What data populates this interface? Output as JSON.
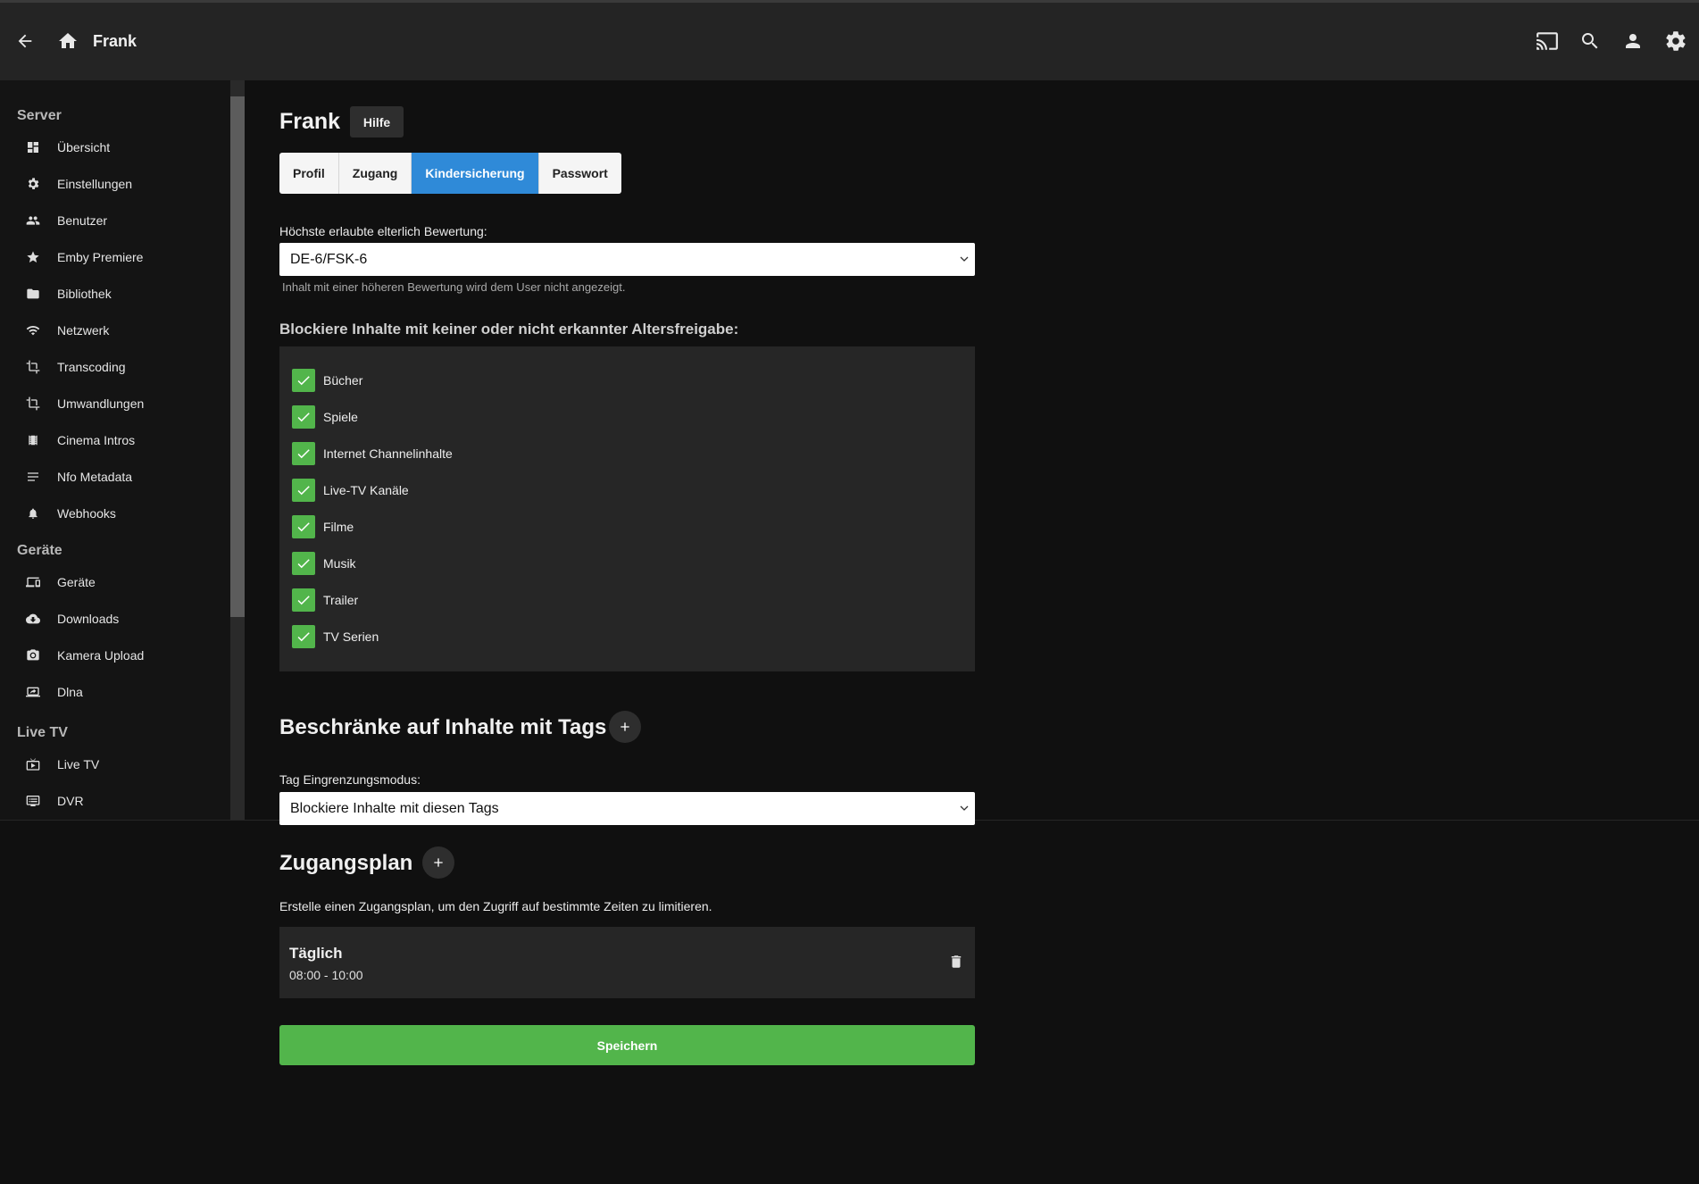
{
  "header": {
    "title": "Frank",
    "icons": [
      "back-arrow-icon",
      "home-icon",
      "cast-icon",
      "search-icon",
      "user-icon",
      "gear-icon"
    ]
  },
  "sidebar": {
    "sections": [
      {
        "title": "Server",
        "items": [
          {
            "label": "Übersicht",
            "icon": "dashboard-icon"
          },
          {
            "label": "Einstellungen",
            "icon": "gear-icon"
          },
          {
            "label": "Benutzer",
            "icon": "people-icon"
          },
          {
            "label": "Emby Premiere",
            "icon": "star-icon"
          },
          {
            "label": "Bibliothek",
            "icon": "folder-icon"
          },
          {
            "label": "Netzwerk",
            "icon": "wifi-icon"
          },
          {
            "label": "Transcoding",
            "icon": "crop-icon"
          },
          {
            "label": "Umwandlungen",
            "icon": "crop-icon"
          },
          {
            "label": "Cinema Intros",
            "icon": "film-icon"
          },
          {
            "label": "Nfo Metadata",
            "icon": "lines-icon"
          },
          {
            "label": "Webhooks",
            "icon": "bell-icon"
          }
        ]
      },
      {
        "title": "Geräte",
        "items": [
          {
            "label": "Geräte",
            "icon": "devices-icon"
          },
          {
            "label": "Downloads",
            "icon": "cloud-download-icon"
          },
          {
            "label": "Kamera Upload",
            "icon": "camera-icon"
          },
          {
            "label": "Dlna",
            "icon": "screen-share-icon"
          }
        ]
      },
      {
        "title": "Live TV",
        "items": [
          {
            "label": "Live TV",
            "icon": "live-tv-icon"
          },
          {
            "label": "DVR",
            "icon": "dvr-icon"
          }
        ]
      }
    ]
  },
  "main": {
    "title": "Frank",
    "help_label": "Hilfe",
    "tabs": [
      {
        "label": "Profil",
        "active": false
      },
      {
        "label": "Zugang",
        "active": false
      },
      {
        "label": "Kindersicherung",
        "active": true
      },
      {
        "label": "Passwort",
        "active": false
      }
    ],
    "rating": {
      "label": "Höchste erlaubte elterlich Bewertung:",
      "value": "DE-6/FSK-6",
      "hint": "Inhalt mit einer höheren Bewertung wird dem User nicht angezeigt."
    },
    "block_unrated": {
      "heading": "Blockiere Inhalte mit keiner oder nicht erkannter Altersfreigabe:",
      "items": [
        {
          "label": "Bücher",
          "checked": true
        },
        {
          "label": "Spiele",
          "checked": true
        },
        {
          "label": "Internet Channelinhalte",
          "checked": true
        },
        {
          "label": "Live-TV Kanäle",
          "checked": true
        },
        {
          "label": "Filme",
          "checked": true
        },
        {
          "label": "Musik",
          "checked": true
        },
        {
          "label": "Trailer",
          "checked": true
        },
        {
          "label": "TV Serien",
          "checked": true
        }
      ]
    },
    "tags": {
      "heading": "Beschränke auf Inhalte mit Tags",
      "mode_label": "Tag Eingrenzungsmodus:",
      "mode_value": "Blockiere Inhalte mit diesen Tags"
    },
    "schedule": {
      "heading": "Zugangsplan",
      "description": "Erstelle einen Zugangsplan, um den Zugriff auf bestimmte Zeiten zu limitieren.",
      "entries": [
        {
          "day": "Täglich",
          "time": "08:00 - 10:00"
        }
      ]
    },
    "save_label": "Speichern"
  },
  "colors": {
    "accent_blue": "#2f8ad8",
    "accent_green": "#52b54b",
    "background": "#101010",
    "header": "#242424",
    "panel": "#262626"
  }
}
